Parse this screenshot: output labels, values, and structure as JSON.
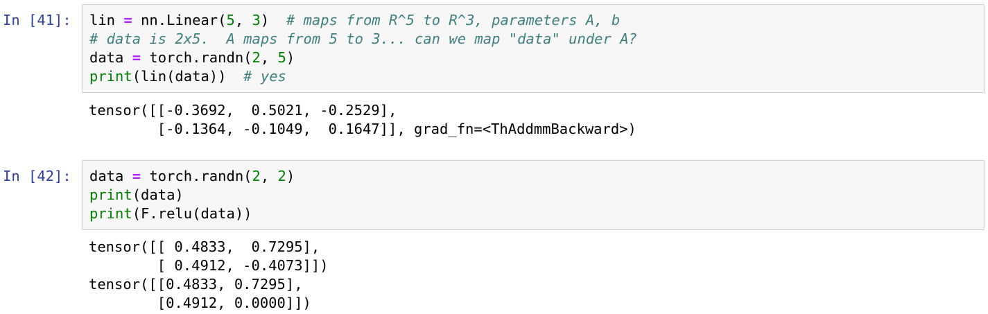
{
  "cells": [
    {
      "prompt": "In [41]:",
      "code": [
        [
          {
            "t": "lin",
            "c": "cm-variable"
          },
          {
            "t": " ",
            "c": "cm-plain"
          },
          {
            "t": "=",
            "c": "cm-operator"
          },
          {
            "t": " nn.Linear(",
            "c": "cm-plain"
          },
          {
            "t": "5",
            "c": "cm-number"
          },
          {
            "t": ", ",
            "c": "cm-plain"
          },
          {
            "t": "3",
            "c": "cm-number"
          },
          {
            "t": ")  ",
            "c": "cm-plain"
          },
          {
            "t": "# maps from R^5 to R^3, parameters A, b",
            "c": "cm-comment"
          }
        ],
        [
          {
            "t": "# data is 2x5.  A maps from 5 to 3... can we map \"data\" under A?",
            "c": "cm-comment"
          }
        ],
        [
          {
            "t": "data",
            "c": "cm-variable"
          },
          {
            "t": " ",
            "c": "cm-plain"
          },
          {
            "t": "=",
            "c": "cm-operator"
          },
          {
            "t": " torch.randn(",
            "c": "cm-plain"
          },
          {
            "t": "2",
            "c": "cm-number"
          },
          {
            "t": ", ",
            "c": "cm-plain"
          },
          {
            "t": "5",
            "c": "cm-number"
          },
          {
            "t": ")",
            "c": "cm-plain"
          }
        ],
        [
          {
            "t": "print",
            "c": "cm-builtin"
          },
          {
            "t": "(lin(data))  ",
            "c": "cm-plain"
          },
          {
            "t": "# yes",
            "c": "cm-comment"
          }
        ]
      ],
      "output": [
        "tensor([[-0.3692,  0.5021, -0.2529],",
        "        [-0.1364, -0.1049,  0.1647]], grad_fn=<ThAddmmBackward>)"
      ]
    },
    {
      "prompt": "In [42]:",
      "code": [
        [
          {
            "t": "data",
            "c": "cm-variable"
          },
          {
            "t": " ",
            "c": "cm-plain"
          },
          {
            "t": "=",
            "c": "cm-operator"
          },
          {
            "t": " torch.randn(",
            "c": "cm-plain"
          },
          {
            "t": "2",
            "c": "cm-number"
          },
          {
            "t": ", ",
            "c": "cm-plain"
          },
          {
            "t": "2",
            "c": "cm-number"
          },
          {
            "t": ")",
            "c": "cm-plain"
          }
        ],
        [
          {
            "t": "print",
            "c": "cm-builtin"
          },
          {
            "t": "(data)",
            "c": "cm-plain"
          }
        ],
        [
          {
            "t": "print",
            "c": "cm-builtin"
          },
          {
            "t": "(F.relu(data))",
            "c": "cm-plain"
          }
        ]
      ],
      "output": [
        "tensor([[ 0.4833,  0.7295],",
        "        [ 0.4912, -0.4073]])",
        "tensor([[0.4833, 0.7295],",
        "        [0.4912, 0.0000]])"
      ]
    }
  ]
}
